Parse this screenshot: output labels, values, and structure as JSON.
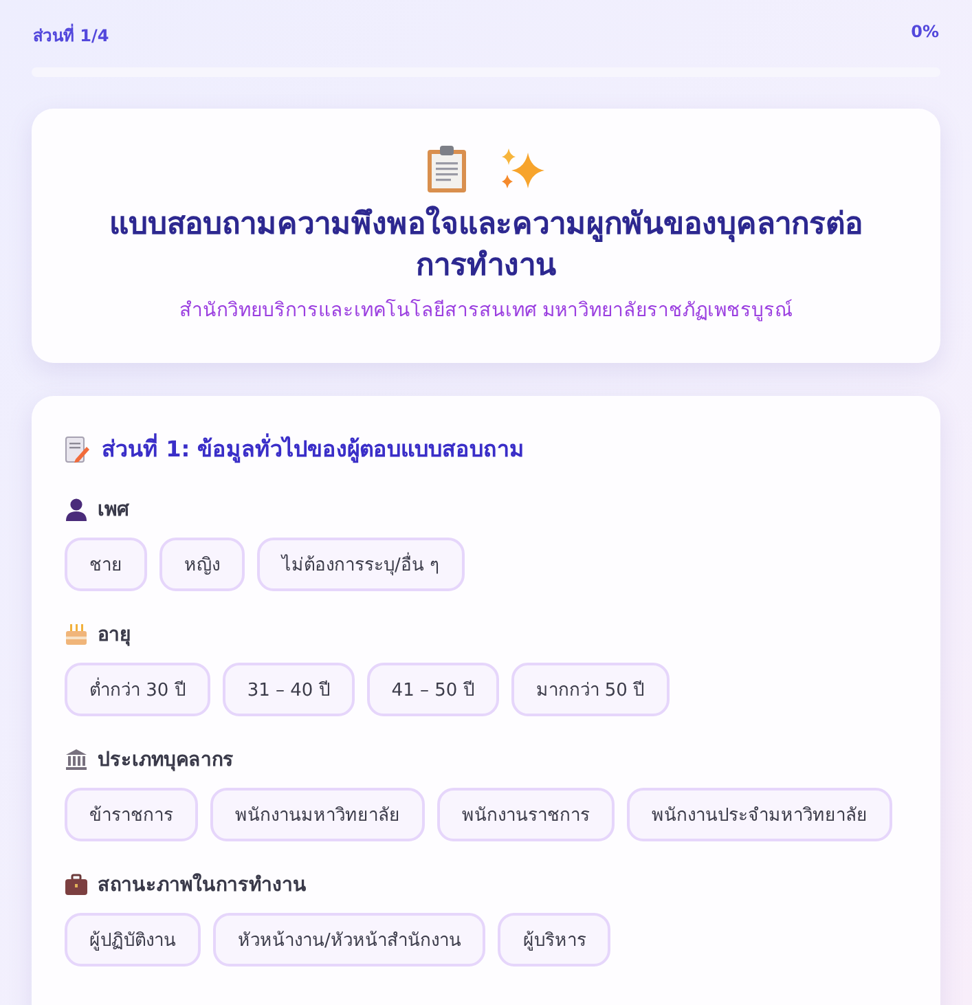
{
  "progress": {
    "label": "ส่วนที่ 1/4",
    "percent": "0%",
    "level": 0
  },
  "header": {
    "title": "แบบสอบถามความพึงพอใจและความผูกพันของบุคลากรต่อการทำงาน",
    "subtitle": "สำนักวิทยบริการและเทคโนโลยีสารสนเทศ มหาวิทยาลัยราชภัฏเพชรบูรณ์"
  },
  "section": {
    "title": "ส่วนที่ 1: ข้อมูลทั่วไปของผู้ตอบแบบสอบถาม",
    "questions": [
      {
        "label": "เพศ",
        "options": [
          {
            "label": "ชาย",
            "selected": false
          },
          {
            "label": "หญิง",
            "selected": false
          },
          {
            "label": "ไม่ต้องการระบุ/อื่น ๆ",
            "selected": false
          }
        ]
      },
      {
        "label": "อายุ",
        "options": [
          {
            "label": "ต่ำกว่า 30 ปี",
            "selected": false
          },
          {
            "label": "31 – 40 ปี",
            "selected": false
          },
          {
            "label": "41 – 50 ปี",
            "selected": false
          },
          {
            "label": "มากกว่า 50 ปี",
            "selected": false
          }
        ]
      },
      {
        "label": "ประเภทบุคลากร",
        "options": [
          {
            "label": "ข้าราชการ",
            "selected": false
          },
          {
            "label": "พนักงานมหาวิทยาลัย",
            "selected": false
          },
          {
            "label": "พนักงานราชการ",
            "selected": false
          },
          {
            "label": "พนักงานประจำมหาวิทยาลัย",
            "selected": false
          }
        ]
      },
      {
        "label": "สถานะภาพในการทำงาน",
        "options": [
          {
            "label": "ผู้ปฏิบัติงาน",
            "selected": false
          },
          {
            "label": "หัวหน้างาน/หัวหน้าสำนักงาน",
            "selected": false
          },
          {
            "label": "ผู้บริหาร",
            "selected": false
          }
        ]
      }
    ]
  }
}
